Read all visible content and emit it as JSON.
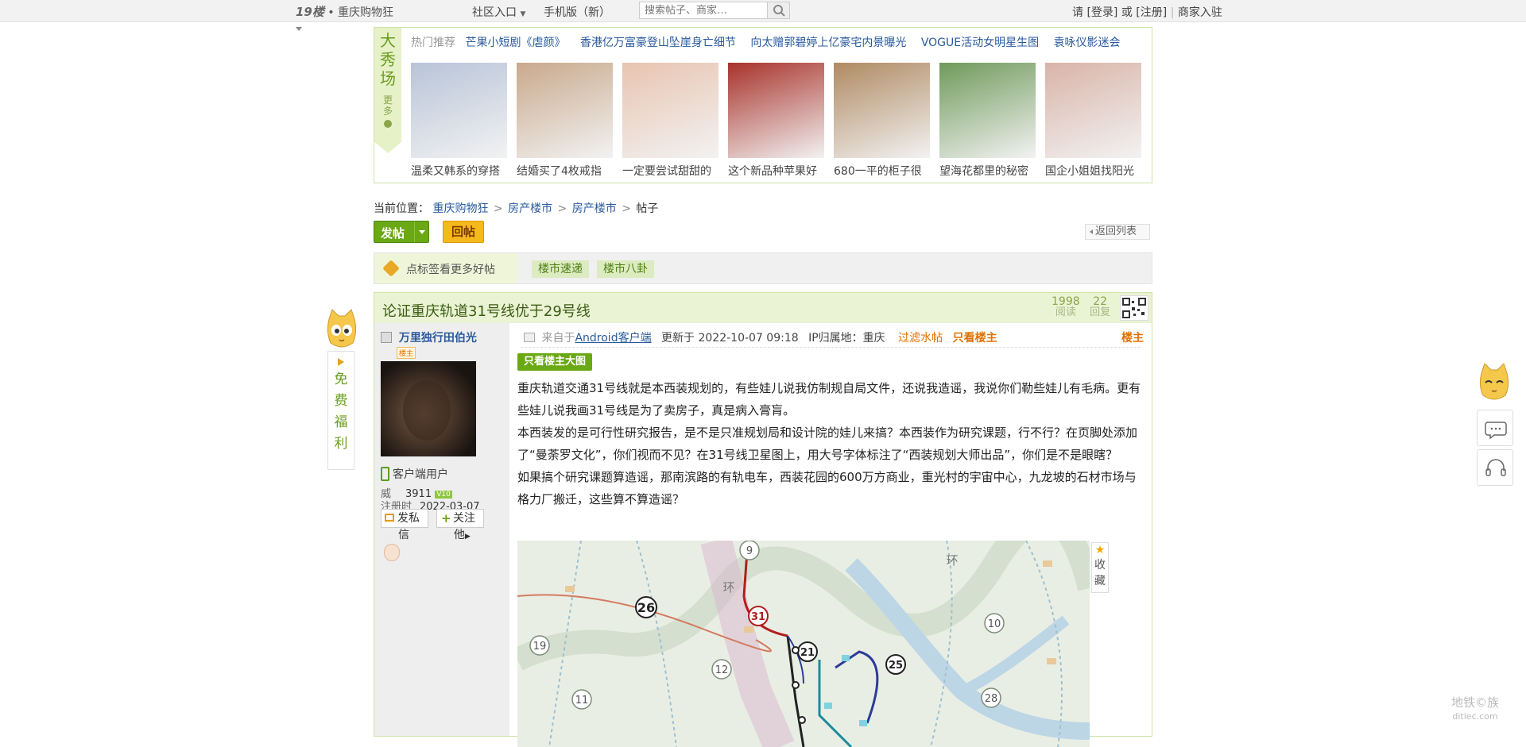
{
  "topbar": {
    "brand_logo": "19楼",
    "brand_sep": "•",
    "brand_name": "重庆购物狂",
    "community": "社区入口",
    "mobile": "手机版（新）",
    "search_placeholder": "搜索帖子、商家…",
    "login_prefix": "请",
    "login": "[登录]",
    "or": "或",
    "register": "[注册]",
    "divider": "|",
    "merchant": "商家入驻"
  },
  "show": {
    "tag_title": "大秀场",
    "more": "更多",
    "hot_label": "热门推荐",
    "hot_links": [
      "芒果小短剧《虐颜》",
      "香港亿万富豪登山坠崖身亡细节",
      "向太赠郭碧婷上亿豪宅内景曝光",
      "VOGUE活动女明星生图",
      "袁咏仪影迷会"
    ],
    "thumbs": [
      {
        "caption": "温柔又韩系的穿搭",
        "color": "#b8c4d8"
      },
      {
        "caption": "结婚买了4枚戒指",
        "color": "#c9a98c"
      },
      {
        "caption": "一定要尝试甜甜的",
        "color": "#e8c4b0"
      },
      {
        "caption": "这个新品种苹果好",
        "color": "#a8322a"
      },
      {
        "caption": "680一平的柜子很",
        "color": "#b08a62"
      },
      {
        "caption": "望海花都里的秘密",
        "color": "#6f9a5a"
      },
      {
        "caption": "国企小姐姐找阳光",
        "color": "#d9b4a8"
      }
    ]
  },
  "breadcrumb": {
    "label": "当前位置：",
    "items": [
      "重庆购物狂",
      "房产楼市",
      "房产楼市"
    ],
    "sep": ">",
    "current": "帖子"
  },
  "actions": {
    "post": "发帖",
    "reply": "回帖",
    "back": "返回列表"
  },
  "tagbar": {
    "label": "点标签看更多好帖",
    "tags": [
      "楼市速递",
      "楼市八卦"
    ]
  },
  "thread": {
    "title": "论证重庆轨道31号线优于29号线",
    "views": "1998",
    "views_label": "阅读",
    "replies": "22",
    "replies_label": "回复"
  },
  "author": {
    "name": "万里独行田伯光",
    "badge": "楼主",
    "client": "客户端用户",
    "wei_label": "威",
    "wei_value": "3911",
    "level": "V10",
    "reg_label": "注册时",
    "reg_date": "2022-03-07",
    "msg_btn": "发私",
    "msg_btn2": "信",
    "follow_btn": "关注",
    "follow_btn2": "他"
  },
  "post": {
    "source_prefix": "来自于",
    "source": "Android客户端",
    "updated": "更新于 2022-10-07 09:18",
    "ip": "IP归属地：重庆",
    "filter": "过滤水帖",
    "only_owner": "只看楼主",
    "floor": "楼主",
    "only_owner_img": "只看楼主大图",
    "paragraphs": [
      "重庆轨道交通31号线就是本西装规划的，有些娃儿说我仿制规自局文件，还说我造谣，我说你们勒些娃儿有毛病。更有些娃儿说我画31号线是为了卖房子，真是病入膏肓。",
      "本西装发的是可行性研究报告，是不是只准规划局和设计院的娃儿来搞？本西装作为研究课题，行不行？在页脚处添加了“曼荼罗文化”，你们视而不见？在31号线卫星图上，用大号字体标注了“西装规划大师出品”，你们是不是眼瞎？",
      "如果搞个研究课题算造谣，那南滨路的有轨电车，西装花园的600万方商业，重光村的宇宙中心，九龙坡的石材市场与格力厂搬迁，这些算不算造谣？"
    ],
    "map_labels": [
      "26",
      "19",
      "12",
      "11",
      "9",
      "环",
      "31",
      "21",
      "25",
      "环",
      "10",
      "28"
    ],
    "fav": "收藏"
  },
  "float": {
    "left_text": [
      "免",
      "费",
      "福",
      "利"
    ]
  },
  "watermark": {
    "line1": "地铁©族",
    "line2": "ditiec.com"
  }
}
